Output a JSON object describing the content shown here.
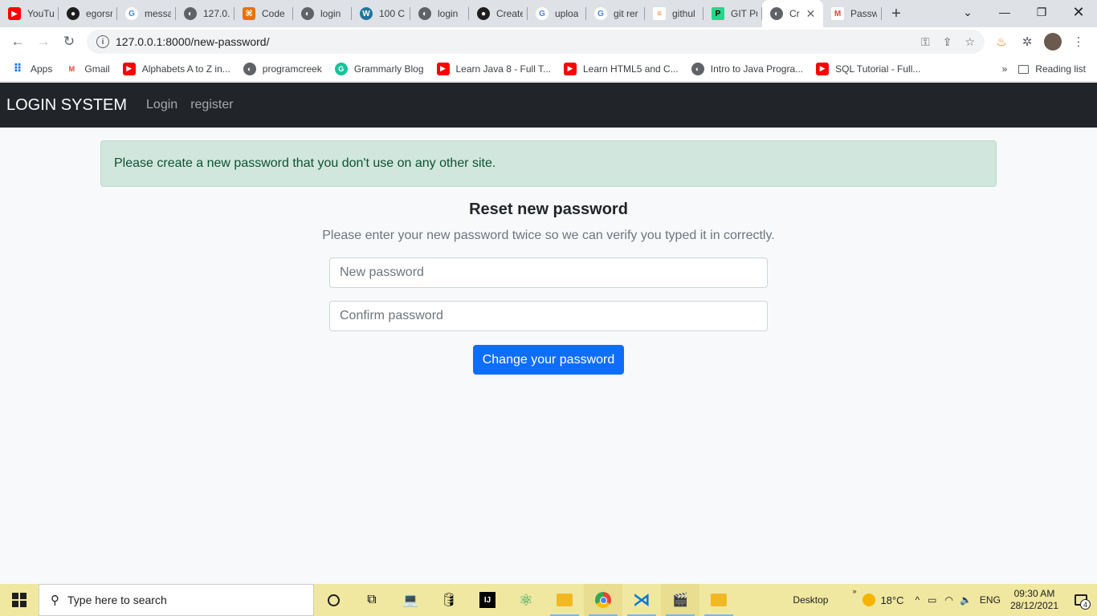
{
  "browser": {
    "tabs": [
      {
        "title": "YouTu",
        "icon": "youtube-icon"
      },
      {
        "title": "egorsr",
        "icon": "github-icon"
      },
      {
        "title": "messa",
        "icon": "google-icon"
      },
      {
        "title": "127.0.",
        "icon": "globe-icon"
      },
      {
        "title": "Code",
        "icon": "code-icon"
      },
      {
        "title": "login",
        "icon": "globe-icon"
      },
      {
        "title": "100 C",
        "icon": "wordpress-icon"
      },
      {
        "title": "login",
        "icon": "globe-icon"
      },
      {
        "title": "Create",
        "icon": "github-icon"
      },
      {
        "title": "uploa",
        "icon": "google-icon"
      },
      {
        "title": "git rer",
        "icon": "google-icon"
      },
      {
        "title": "githul",
        "icon": "stackoverflow-icon"
      },
      {
        "title": "GIT Pu",
        "icon": "pycharm-icon"
      },
      {
        "title": "Cr",
        "icon": "globe-icon",
        "active": true
      },
      {
        "title": "Passw",
        "icon": "gmail-icon"
      }
    ],
    "url": "127.0.0.1:8000/new-password/",
    "bookmarks": [
      {
        "label": "Apps",
        "icon": "apps-grid-icon"
      },
      {
        "label": "Gmail",
        "icon": "gmail-icon"
      },
      {
        "label": "Alphabets A to Z in...",
        "icon": "youtube-icon"
      },
      {
        "label": "programcreek",
        "icon": "globe-icon"
      },
      {
        "label": "Grammarly Blog",
        "icon": "grammarly-icon"
      },
      {
        "label": "Learn Java 8 - Full T...",
        "icon": "youtube-icon"
      },
      {
        "label": "Learn HTML5 and C...",
        "icon": "youtube-icon"
      },
      {
        "label": "Intro to Java Progra...",
        "icon": "globe-icon"
      },
      {
        "label": "SQL Tutorial - Full...",
        "icon": "youtube-icon"
      }
    ],
    "more_bookmarks": "»",
    "reading_list": "Reading list"
  },
  "page": {
    "brand": "LOGIN SYSTEM",
    "nav": [
      "Login",
      "register"
    ],
    "alert": "Please create a new password that you don't use on any other site.",
    "heading": "Reset new password",
    "subtitle": "Please enter your new password twice so we can verify you typed it in correctly.",
    "new_password_placeholder": "New password",
    "confirm_password_placeholder": "Confirm password",
    "submit_label": "Change your password"
  },
  "taskbar": {
    "search_placeholder": "Type here to search",
    "desktop_label": "Desktop",
    "weather": "18°C",
    "language": "ENG",
    "time": "09:30 AM",
    "date": "28/12/2021",
    "notifications": "4"
  }
}
